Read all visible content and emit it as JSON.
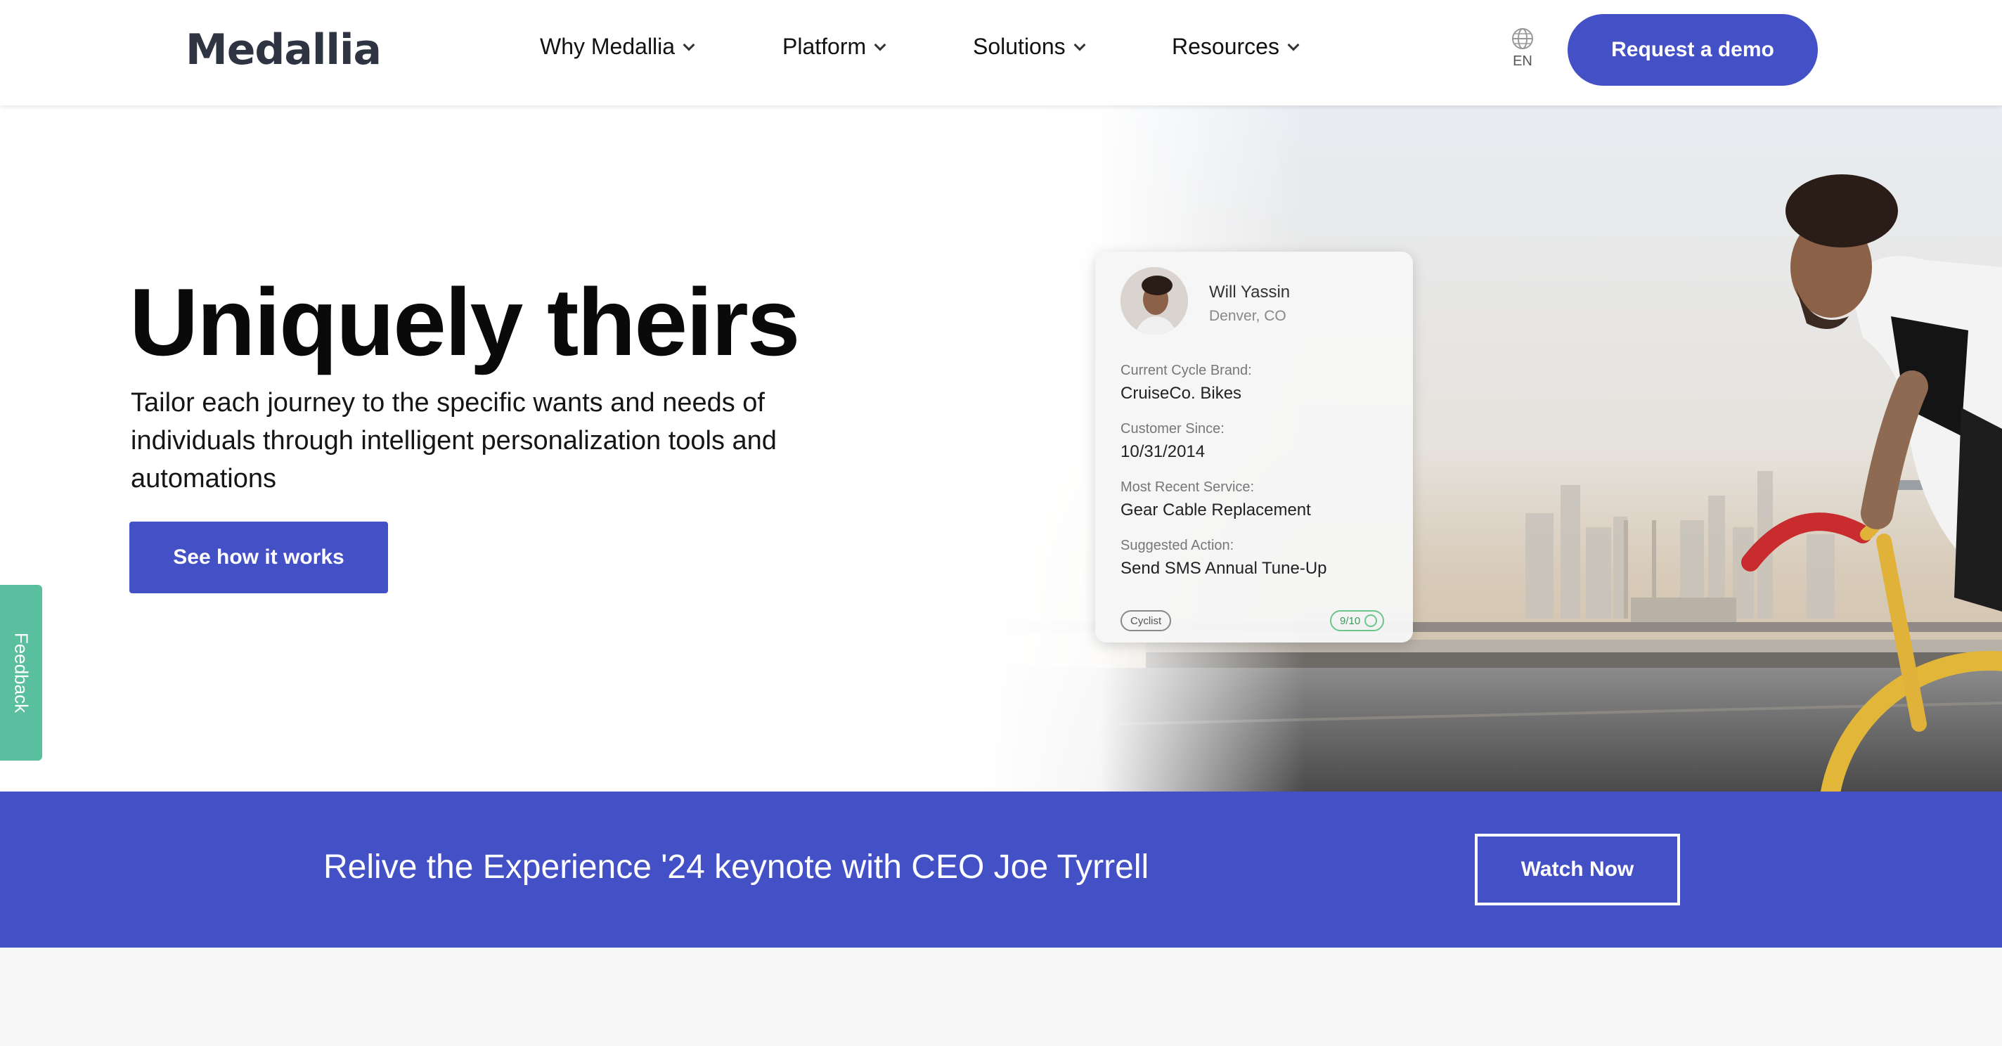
{
  "header": {
    "logo": "Medallia",
    "nav": [
      {
        "label": "Why Medallia"
      },
      {
        "label": "Platform"
      },
      {
        "label": "Solutions"
      },
      {
        "label": "Resources"
      }
    ],
    "language": "EN",
    "demo_button": "Request a demo"
  },
  "hero": {
    "title": "Uniquely theirs",
    "subtitle": "Tailor each journey to the specific wants and needs of individuals through intelligent personalization tools and automations",
    "cta": "See how it works"
  },
  "profile_card": {
    "name": "Will Yassin",
    "location": "Denver, CO",
    "fields": [
      {
        "label": "Current Cycle Brand:",
        "value": "CruiseCo. Bikes"
      },
      {
        "label": "Customer Since:",
        "value": "10/31/2014"
      },
      {
        "label": "Most Recent Service:",
        "value": "Gear Cable Replacement"
      },
      {
        "label": "Suggested Action:",
        "value": "Send SMS Annual Tune-Up"
      }
    ],
    "tag": "Cyclist",
    "score": "9/10"
  },
  "feedback_tab": "Feedback",
  "banner": {
    "text": "Relive the Experience '24 keynote with CEO Joe Tyrrell",
    "button": "Watch Now"
  },
  "colors": {
    "brand": "#4451c6",
    "feedback": "#5abf9e",
    "logo": "#2f3442"
  },
  "icons": {
    "language": "globe-icon",
    "dropdown": "chevron-down-icon",
    "score": "check-circle-icon"
  }
}
